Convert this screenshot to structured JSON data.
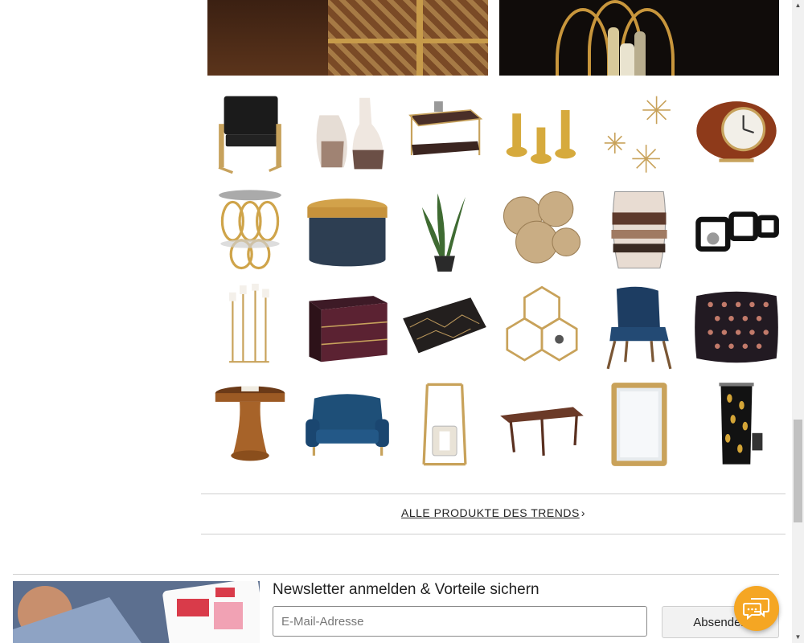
{
  "products": [
    {
      "name": "Sessel schwarz Samt"
    },
    {
      "name": "Vasen Set"
    },
    {
      "name": "Couchtisch"
    },
    {
      "name": "Kerzenhalter gold"
    },
    {
      "name": "Wanddeko Sterne"
    },
    {
      "name": "Tischuhr"
    },
    {
      "name": "Beistelltisch gold"
    },
    {
      "name": "Dose mit Deckel"
    },
    {
      "name": "Kunstpflanze"
    },
    {
      "name": "Wanddeko Blüten"
    },
    {
      "name": "Windlicht Glas"
    },
    {
      "name": "Wandregal Würfel"
    },
    {
      "name": "Kerzenständer"
    },
    {
      "name": "Kommode"
    },
    {
      "name": "Tapete"
    },
    {
      "name": "Wandregal Waben"
    },
    {
      "name": "Stuhl blau"
    },
    {
      "name": "Kissen"
    },
    {
      "name": "Beistelltisch Holz"
    },
    {
      "name": "Sofa blau"
    },
    {
      "name": "Laterne"
    },
    {
      "name": "Couchtisch Holz"
    },
    {
      "name": "Spiegel"
    },
    {
      "name": "Vorhang"
    }
  ],
  "all_products_link": "ALLE PRODUKTE DES TRENDS",
  "newsletter": {
    "title": "Newsletter anmelden & Vorteile sichern",
    "email_placeholder": "E-Mail-Adresse",
    "submit_label": "Absenden"
  },
  "colors": {
    "chat_button": "#f5a623",
    "gold": "#c8963c",
    "navy": "#1d3d62"
  }
}
